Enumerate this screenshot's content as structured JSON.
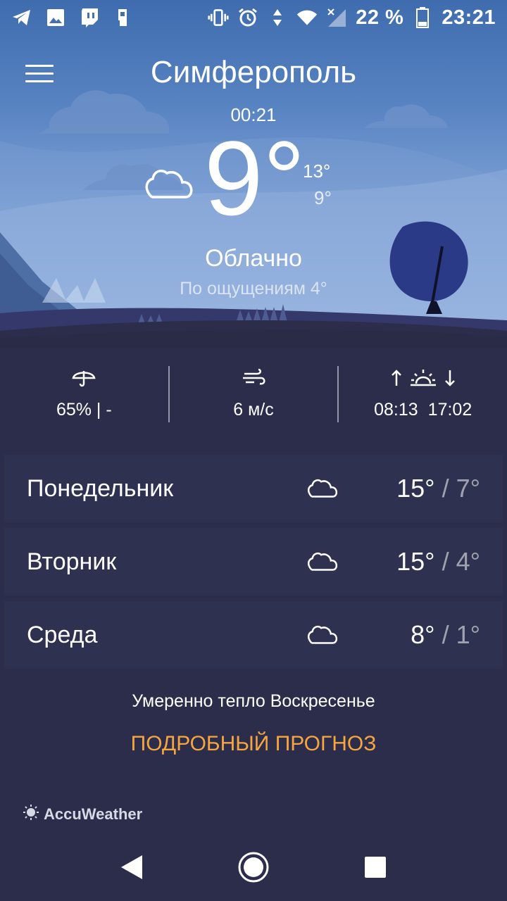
{
  "status_bar": {
    "battery_percent": "22 %",
    "time": "23:21",
    "icons_left": [
      "telegram-icon",
      "image-icon",
      "twitch-icon",
      "sim-icon"
    ],
    "icons_right": [
      "vibrate-icon",
      "alarm-icon",
      "data-arrows-icon",
      "wifi-icon",
      "signal-icon",
      "battery-icon"
    ]
  },
  "header": {
    "city": "Симферополь",
    "local_time": "00:21"
  },
  "current": {
    "temperature": "9°",
    "high": "13°",
    "low": "9°",
    "condition": "Облачно",
    "feels_like": "По ощущениям 4°",
    "condition_icon": "cloud-icon"
  },
  "stats": {
    "precipitation": "65% | -",
    "wind": "6 м/с",
    "sunrise": "08:13",
    "sunset": "17:02"
  },
  "forecast": [
    {
      "day": "Понедельник",
      "high": "15°",
      "low": "/ 7°",
      "icon": "cloud-icon"
    },
    {
      "day": "Вторник",
      "high": "15°",
      "low": "/ 4°",
      "icon": "cloud-icon"
    },
    {
      "day": "Среда",
      "high": "8°",
      "low": "/ 1°",
      "icon": "cloud-icon"
    }
  ],
  "note": "Умеренно тепло Воскресенье",
  "detailed_link": "ПОДРОБНЫЙ ПРОГНОЗ",
  "brand": "AccuWeather",
  "colors": {
    "background": "#2b2d4a",
    "row_background": "#2f3150",
    "accent": "#f6a640",
    "sky_top": "#3f6cae",
    "sky_bottom": "#a9c1e6"
  }
}
